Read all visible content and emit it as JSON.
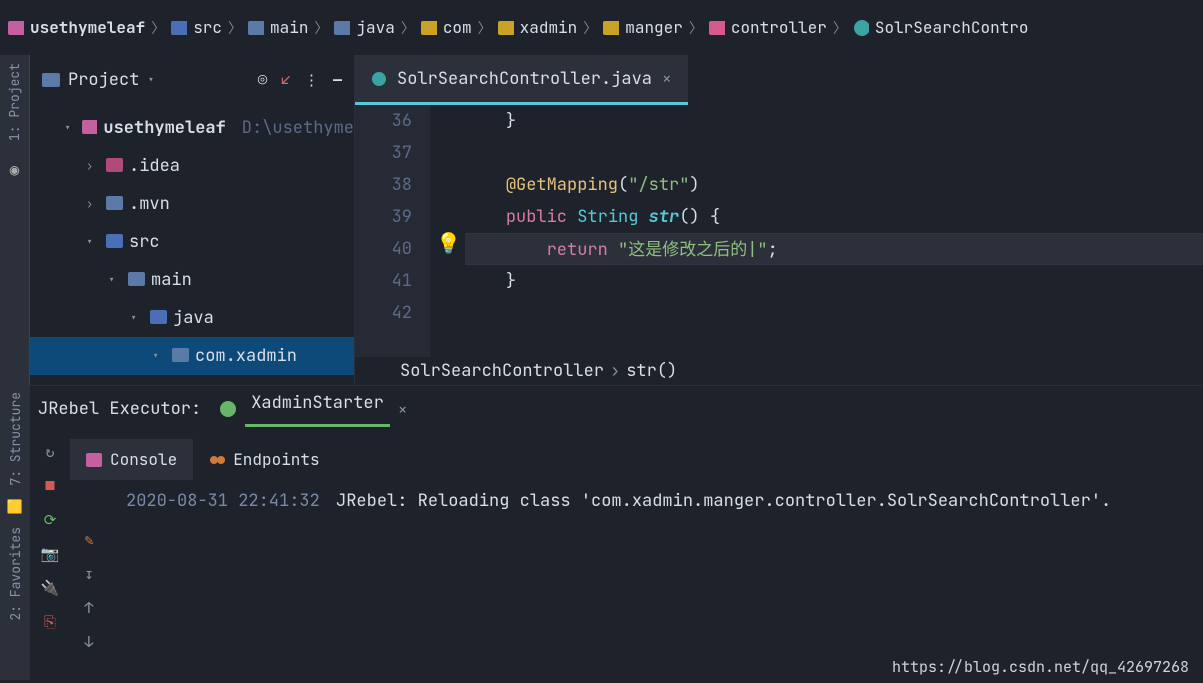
{
  "breadcrumb": {
    "segments": [
      {
        "text": "usethymeleaf",
        "bold": true
      },
      {
        "text": "src"
      },
      {
        "text": "main"
      },
      {
        "text": "java"
      },
      {
        "text": "com"
      },
      {
        "text": "xadmin"
      },
      {
        "text": "manger"
      },
      {
        "text": "controller"
      },
      {
        "text": "SolrSearchContro"
      }
    ]
  },
  "left_strip": {
    "project_label": "1: Project"
  },
  "project_panel": {
    "title": "Project",
    "root": {
      "name": "usethymeleaf",
      "path": "D:\\usethyme"
    },
    "tree": {
      "idea": ".idea",
      "mvn": ".mvn",
      "src": "src",
      "main": "main",
      "java": "java",
      "package": "com.xadmin"
    }
  },
  "editor": {
    "tab_name": "SolrSearchController.java",
    "gutter": [
      "36",
      "37",
      "38",
      "39",
      "40",
      "41",
      "42"
    ],
    "code": {
      "ann": "@GetMapping",
      "ann_arg": "\"/str\"",
      "kw_public": "public",
      "type_string": "String",
      "fn_name": "str",
      "kw_return": "return",
      "str_literal": "\"这是修改之后的|\"",
      "brace_close": "}"
    },
    "footer_class": "SolrSearchController",
    "footer_method": "str()"
  },
  "jrebel": {
    "title": "JRebel Executor:",
    "config": "XadminStarter",
    "tabs": {
      "console": "Console",
      "endpoints": "Endpoints"
    },
    "output_ts": "2020-08-31 22:41:32",
    "output_label": "JRebel: Reloading class",
    "output_class": "'com.xadmin.manger.controller.SolrSearchController'."
  },
  "bottom_strip": {
    "structure_label": "7: Structure",
    "favorites_label": "2: Favorites"
  },
  "watermark": "https://blog.csdn.net/qq_42697268"
}
